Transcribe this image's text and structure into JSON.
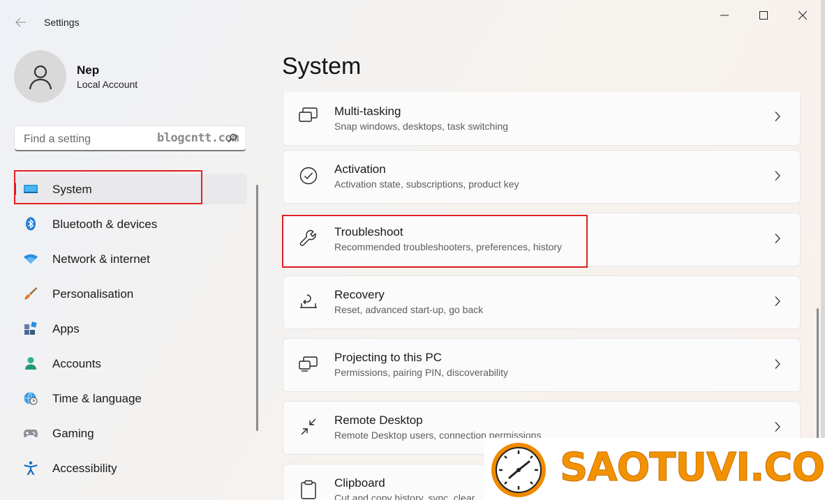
{
  "window": {
    "title": "Settings"
  },
  "user": {
    "name": "Nep",
    "account_type": "Local Account"
  },
  "search": {
    "placeholder": "Find a setting",
    "watermark": "blogcntt.com"
  },
  "nav": [
    {
      "label": "System",
      "icon": "system-icon",
      "active": true
    },
    {
      "label": "Bluetooth & devices",
      "icon": "bluetooth-icon"
    },
    {
      "label": "Network & internet",
      "icon": "wifi-icon"
    },
    {
      "label": "Personalisation",
      "icon": "brush-icon"
    },
    {
      "label": "Apps",
      "icon": "apps-icon"
    },
    {
      "label": "Accounts",
      "icon": "accounts-icon"
    },
    {
      "label": "Time & language",
      "icon": "globe-clock-icon"
    },
    {
      "label": "Gaming",
      "icon": "gamepad-icon"
    },
    {
      "label": "Accessibility",
      "icon": "accessibility-icon"
    }
  ],
  "page": {
    "title": "System"
  },
  "cards": [
    {
      "title": "Multi-tasking",
      "subtitle": "Snap windows, desktops, task switching",
      "icon": "multitasking-icon"
    },
    {
      "title": "Activation",
      "subtitle": "Activation state, subscriptions, product key",
      "icon": "checkmark-circle-icon"
    },
    {
      "title": "Troubleshoot",
      "subtitle": "Recommended troubleshooters, preferences, history",
      "icon": "wrench-icon",
      "highlighted": true
    },
    {
      "title": "Recovery",
      "subtitle": "Reset, advanced start-up, go back",
      "icon": "recovery-icon"
    },
    {
      "title": "Projecting to this PC",
      "subtitle": "Permissions, pairing PIN, discoverability",
      "icon": "projecting-icon"
    },
    {
      "title": "Remote Desktop",
      "subtitle": "Remote Desktop users, connection permissions",
      "icon": "remote-desktop-icon"
    },
    {
      "title": "Clipboard",
      "subtitle": "Cut and copy history, sync, clear",
      "icon": "clipboard-icon"
    }
  ],
  "watermark_logo": {
    "text": "SAOTUVI.COM"
  },
  "colors": {
    "accent": "#005fb8",
    "highlight": "#e02020",
    "watermark": "#f39200"
  }
}
